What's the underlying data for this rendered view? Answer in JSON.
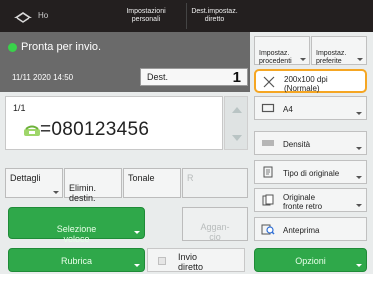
{
  "topbar": {
    "home_label": "Ho",
    "btn_settings": "Impostazioni\npersonali",
    "btn_default": "Dest.impostaz.\ndiretto"
  },
  "status": {
    "text": "Pronta per invio.",
    "datetime": "11/11 2020 14:50",
    "dest_label": "Dest.",
    "dest_count": "1",
    "dot_color": "#39d24a"
  },
  "entry": {
    "counter": "1/1",
    "fax_number": "=080123456"
  },
  "buttons": {
    "details": "Dettagli",
    "remove_dest": "Elimin.\ndestin.",
    "tone": "Tonale",
    "r": "R",
    "quick_select": "Selezione\nveloce",
    "hook": "Aggan-\ncio",
    "address_book": "Rubrica",
    "direct_send": "Invio\ndiretto",
    "options": "Opzioni"
  },
  "right_panel": {
    "settings_procedures": "Impostaz.\nprocedenti",
    "settings_favorites": "Impostaz.\npreferite",
    "items": [
      {
        "label": "200x100 dpi\n(Normale)",
        "icon": "resolution-icon",
        "selected": true
      },
      {
        "label": "A4",
        "icon": "paper-size-icon",
        "selected": false
      },
      {
        "label": "Densità",
        "icon": "density-icon",
        "selected": false
      },
      {
        "label": "Tipo di originale",
        "icon": "original-type-icon",
        "selected": false
      },
      {
        "label": "Originale\nfronte retro",
        "icon": "duplex-icon",
        "selected": false
      },
      {
        "label": "Anteprima",
        "icon": "preview-icon",
        "selected": false
      }
    ]
  },
  "colors": {
    "accent_green": "#2fa84a",
    "selected_outline": "#f5a623",
    "topbar": "#231f1f",
    "status_bg": "#6a6a6a"
  }
}
